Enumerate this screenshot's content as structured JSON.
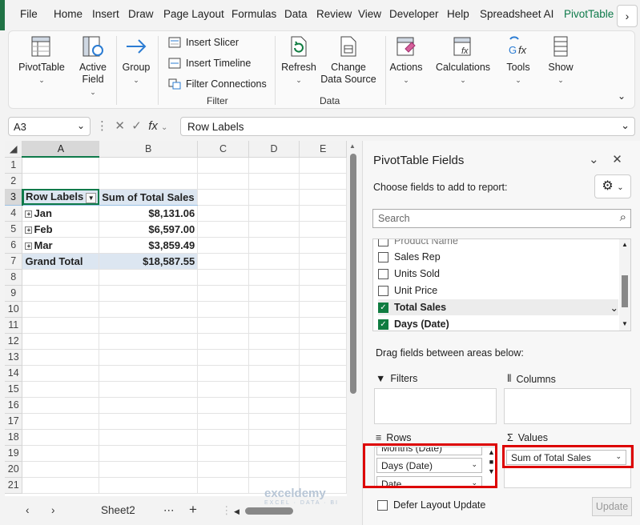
{
  "menu": {
    "tabs": [
      "File",
      "Home",
      "Insert",
      "Draw",
      "Page Layout",
      "Formulas",
      "Data",
      "Review",
      "View",
      "Developer",
      "Help",
      "Spreadsheet AI",
      "PivotTable"
    ],
    "active": "PivotTable",
    "accent": "#0e7a4a"
  },
  "ribbon": {
    "pivottable": "PivotTable",
    "active_field": "Active Field",
    "group": "Group",
    "insert_slicer": "Insert Slicer",
    "insert_timeline": "Insert Timeline",
    "filter_connections": "Filter Connections",
    "filter_group": "Filter",
    "refresh": "Refresh",
    "change_data_source": "Change Data Source",
    "data_group": "Data",
    "actions": "Actions",
    "calculations": "Calculations",
    "tools": "Tools",
    "show": "Show"
  },
  "formula_bar": {
    "name_box": "A3",
    "formula": "Row Labels"
  },
  "grid": {
    "columns": [
      "A",
      "B",
      "C",
      "D",
      "E"
    ],
    "rows": [
      "1",
      "2",
      "3",
      "4",
      "5",
      "6",
      "7",
      "8",
      "9",
      "10",
      "11",
      "12",
      "13",
      "14",
      "15",
      "16",
      "17",
      "18",
      "19",
      "20",
      "21"
    ],
    "pivot": {
      "header_row_labels": "Row Labels",
      "header_values": "Sum of Total Sales",
      "rows": [
        {
          "label": "Jan",
          "value": "$8,131.06"
        },
        {
          "label": "Feb",
          "value": "$6,597.00"
        },
        {
          "label": "Mar",
          "value": "$3,859.49"
        }
      ],
      "total_label": "Grand Total",
      "total_value": "$18,587.55"
    }
  },
  "sheets": {
    "active": "Sheet2"
  },
  "pivot_panel": {
    "title": "PivotTable Fields",
    "subtitle": "Choose fields to add to report:",
    "search_placeholder": "Search",
    "fields": [
      {
        "name": "Product Name",
        "checked": false
      },
      {
        "name": "Sales Rep",
        "checked": false
      },
      {
        "name": "Units Sold",
        "checked": false
      },
      {
        "name": "Unit Price",
        "checked": false
      },
      {
        "name": "Total Sales",
        "checked": true
      },
      {
        "name": "Days (Date)",
        "checked": true
      }
    ],
    "drag_hint": "Drag fields between areas below:",
    "filters_label": "Filters",
    "columns_label": "Columns",
    "rows_label": "Rows",
    "values_label": "Values",
    "rows_items": [
      "Months (Date)",
      "Days (Date)",
      "Date"
    ],
    "values_items": [
      "Sum of Total Sales"
    ],
    "defer_label": "Defer Layout Update",
    "update_label": "Update"
  },
  "watermark": {
    "brand": "exceldemy",
    "tagline": "EXCEL · DATA · BI"
  }
}
